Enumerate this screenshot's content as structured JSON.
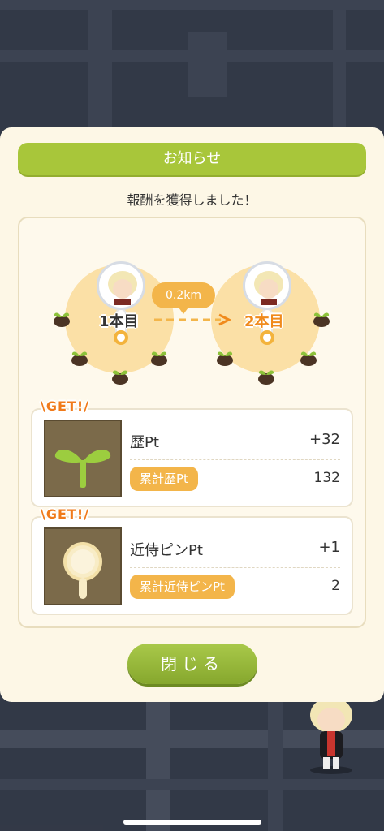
{
  "dialog": {
    "title": "お知らせ",
    "subtitle": "報酬を獲得しました！",
    "close_label": "閉じる"
  },
  "map_route": {
    "distance": "0.2km",
    "from_label": "1本目",
    "to_label": "2本目"
  },
  "rewards": [
    {
      "get_badge": "\\GET!/",
      "name": "歴Pt",
      "value": "+32",
      "total_label": "累計歴Pt",
      "total_value": "132"
    },
    {
      "get_badge": "\\GET!/",
      "name": "近侍ピンPt",
      "value": "+1",
      "total_label": "累計近侍ピンPt",
      "total_value": "2"
    }
  ],
  "colors": {
    "accent_green": "#a8c63a",
    "accent_orange": "#f3b54a",
    "modal_bg": "#fdf7e6"
  }
}
